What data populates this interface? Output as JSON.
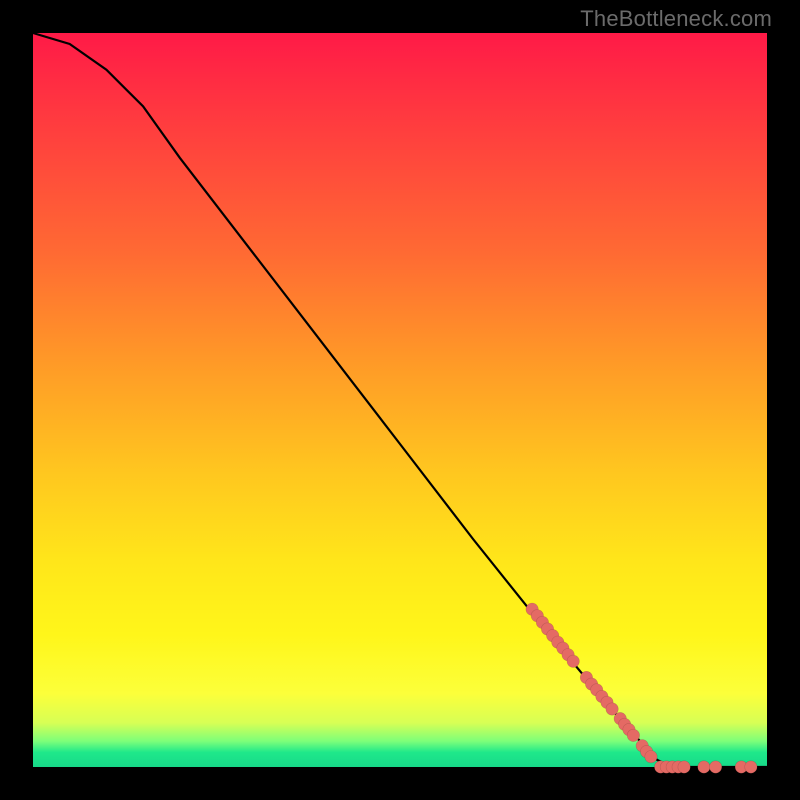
{
  "watermark": "TheBottleneck.com",
  "colors": {
    "frame": "#000000",
    "dot_fill": "#e46a64",
    "curve_stroke": "#000000"
  },
  "chart_data": {
    "type": "line",
    "title": "",
    "xlabel": "",
    "ylabel": "",
    "xlim": [
      0,
      100
    ],
    "ylim": [
      0,
      100
    ],
    "grid": false,
    "legend": false,
    "curve": [
      {
        "x": 0,
        "y": 100
      },
      {
        "x": 5,
        "y": 98.5
      },
      {
        "x": 10,
        "y": 95
      },
      {
        "x": 15,
        "y": 90
      },
      {
        "x": 20,
        "y": 83
      },
      {
        "x": 30,
        "y": 70
      },
      {
        "x": 40,
        "y": 57
      },
      {
        "x": 50,
        "y": 44
      },
      {
        "x": 60,
        "y": 31
      },
      {
        "x": 70,
        "y": 18.5
      },
      {
        "x": 80,
        "y": 6.5
      },
      {
        "x": 85,
        "y": 1
      },
      {
        "x": 87,
        "y": 0
      },
      {
        "x": 100,
        "y": 0
      }
    ],
    "dots_on_curve": [
      {
        "x": 68.0,
        "y": 21.5
      },
      {
        "x": 68.7,
        "y": 20.6
      },
      {
        "x": 69.4,
        "y": 19.7
      },
      {
        "x": 70.1,
        "y": 18.8
      },
      {
        "x": 70.8,
        "y": 17.9
      },
      {
        "x": 71.5,
        "y": 17.0
      },
      {
        "x": 72.2,
        "y": 16.2
      },
      {
        "x": 72.9,
        "y": 15.3
      },
      {
        "x": 73.6,
        "y": 14.4
      },
      {
        "x": 75.4,
        "y": 12.2
      },
      {
        "x": 76.1,
        "y": 11.3
      },
      {
        "x": 76.8,
        "y": 10.5
      },
      {
        "x": 77.5,
        "y": 9.6
      },
      {
        "x": 78.2,
        "y": 8.8
      },
      {
        "x": 78.9,
        "y": 7.9
      },
      {
        "x": 80.0,
        "y": 6.6
      },
      {
        "x": 80.6,
        "y": 5.8
      },
      {
        "x": 81.2,
        "y": 5.1
      },
      {
        "x": 81.8,
        "y": 4.3
      },
      {
        "x": 83.0,
        "y": 2.9
      },
      {
        "x": 83.6,
        "y": 2.1
      },
      {
        "x": 84.2,
        "y": 1.4
      }
    ],
    "dots_on_axis": [
      {
        "x": 85.5,
        "y": 0
      },
      {
        "x": 86.3,
        "y": 0
      },
      {
        "x": 87.1,
        "y": 0
      },
      {
        "x": 87.9,
        "y": 0
      },
      {
        "x": 88.7,
        "y": 0
      },
      {
        "x": 91.4,
        "y": 0
      },
      {
        "x": 93.0,
        "y": 0
      },
      {
        "x": 96.5,
        "y": 0
      },
      {
        "x": 97.8,
        "y": 0
      }
    ]
  }
}
